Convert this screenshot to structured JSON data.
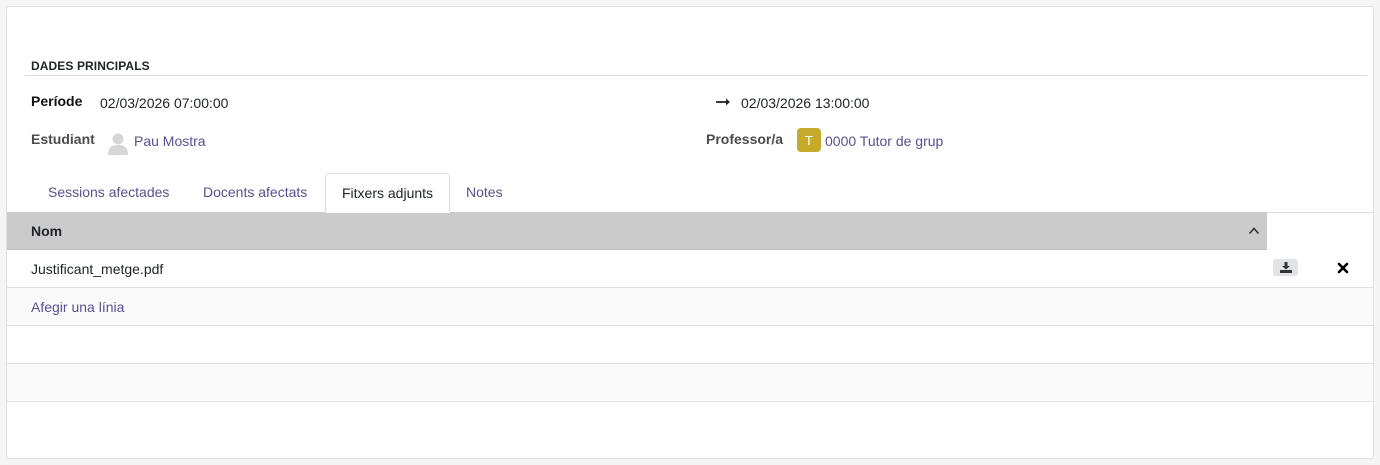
{
  "section": {
    "title": "DADES PRINCIPALS"
  },
  "periode": {
    "label": "Període",
    "start": "02/03/2026 07:00:00",
    "end": "02/03/2026 13:00:00"
  },
  "estudiant": {
    "label": "Estudiant",
    "name": "Pau Mostra"
  },
  "professor": {
    "label": "Professor/a",
    "avatar_letter": "T",
    "name": "0000 Tutor de grup",
    "avatar_color": "#c5a92a"
  },
  "tabs": [
    {
      "label": "Sessions afectades",
      "active": false
    },
    {
      "label": "Docents afectats",
      "active": false
    },
    {
      "label": "Fitxers adjunts",
      "active": true
    },
    {
      "label": "Notes",
      "active": false
    }
  ],
  "table": {
    "column_header": "Nom",
    "rows": [
      {
        "nom": "Justificant_metge.pdf"
      }
    ],
    "add_line_label": "Afegir una línia"
  },
  "colors": {
    "link": "#5c4f8e",
    "header_bg": "#cbcbcb"
  }
}
